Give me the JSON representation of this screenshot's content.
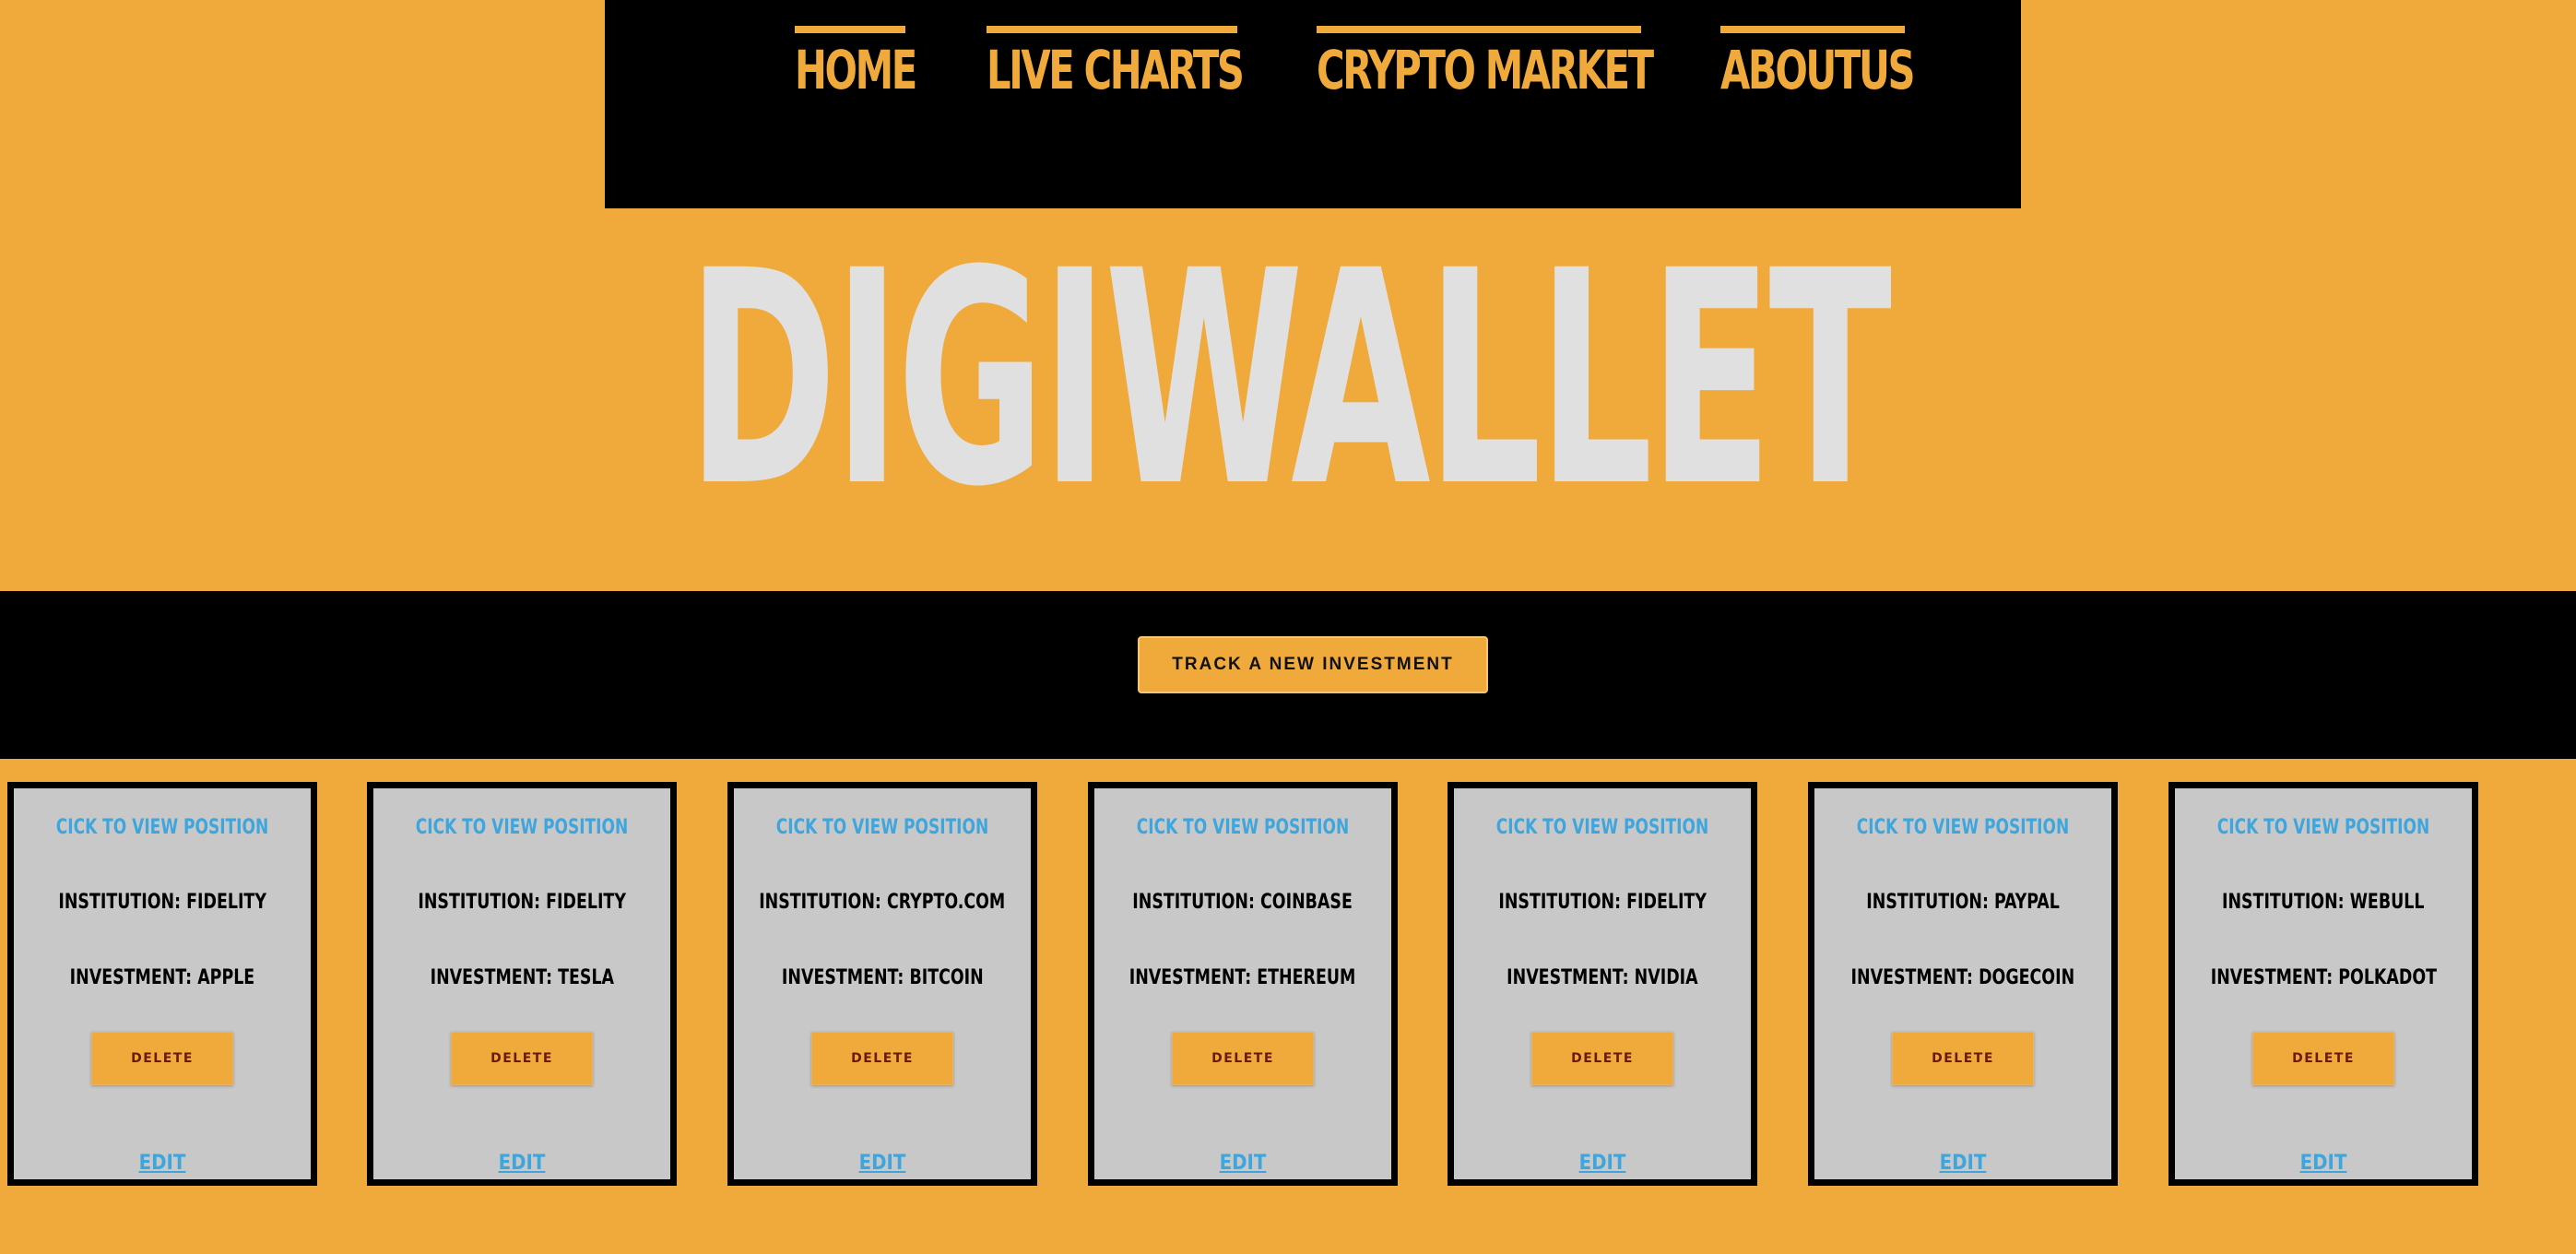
{
  "colors": {
    "background": "#F0A93B",
    "nav_background": "#000000",
    "accent": "#F0A93B",
    "title": "#E0E0E0",
    "card_background": "#C8C8C8",
    "link": "#3EA6DD"
  },
  "nav": {
    "items": [
      {
        "label": "HOME"
      },
      {
        "label": "LIVE CHARTS"
      },
      {
        "label": "CRYPTO MARKET"
      },
      {
        "label": "ABOUTUS"
      }
    ]
  },
  "hero": {
    "title": "DIGIWALLET"
  },
  "cta": {
    "label": "TRACK A NEW INVESTMENT"
  },
  "cards": [
    {
      "view_label": "CICK TO VIEW POSITION",
      "institution": "INSTITUTION: FIDELITY",
      "investment": "INVESTMENT: APPLE",
      "delete_label": "DELETE",
      "edit_label": "EDIT"
    },
    {
      "view_label": "CICK TO VIEW POSITION",
      "institution": "INSTITUTION: FIDELITY",
      "investment": "INVESTMENT: TESLA",
      "delete_label": "DELETE",
      "edit_label": "EDIT"
    },
    {
      "view_label": "CICK TO VIEW POSITION",
      "institution": "INSTITUTION: CRYPTO.COM",
      "investment": "INVESTMENT: BITCOIN",
      "delete_label": "DELETE",
      "edit_label": "EDIT"
    },
    {
      "view_label": "CICK TO VIEW POSITION",
      "institution": "INSTITUTION: COINBASE",
      "investment": "INVESTMENT: ETHEREUM",
      "delete_label": "DELETE",
      "edit_label": "EDIT"
    },
    {
      "view_label": "CICK TO VIEW POSITION",
      "institution": "INSTITUTION: FIDELITY",
      "investment": "INVESTMENT: NVIDIA",
      "delete_label": "DELETE",
      "edit_label": "EDIT"
    },
    {
      "view_label": "CICK TO VIEW POSITION",
      "institution": "INSTITUTION: PAYPAL",
      "investment": "INVESTMENT: DOGECOIN",
      "delete_label": "DELETE",
      "edit_label": "EDIT"
    },
    {
      "view_label": "CICK TO VIEW POSITION",
      "institution": "INSTITUTION: WEBULL",
      "investment": "INVESTMENT: POLKADOT",
      "delete_label": "DELETE",
      "edit_label": "EDIT"
    }
  ]
}
